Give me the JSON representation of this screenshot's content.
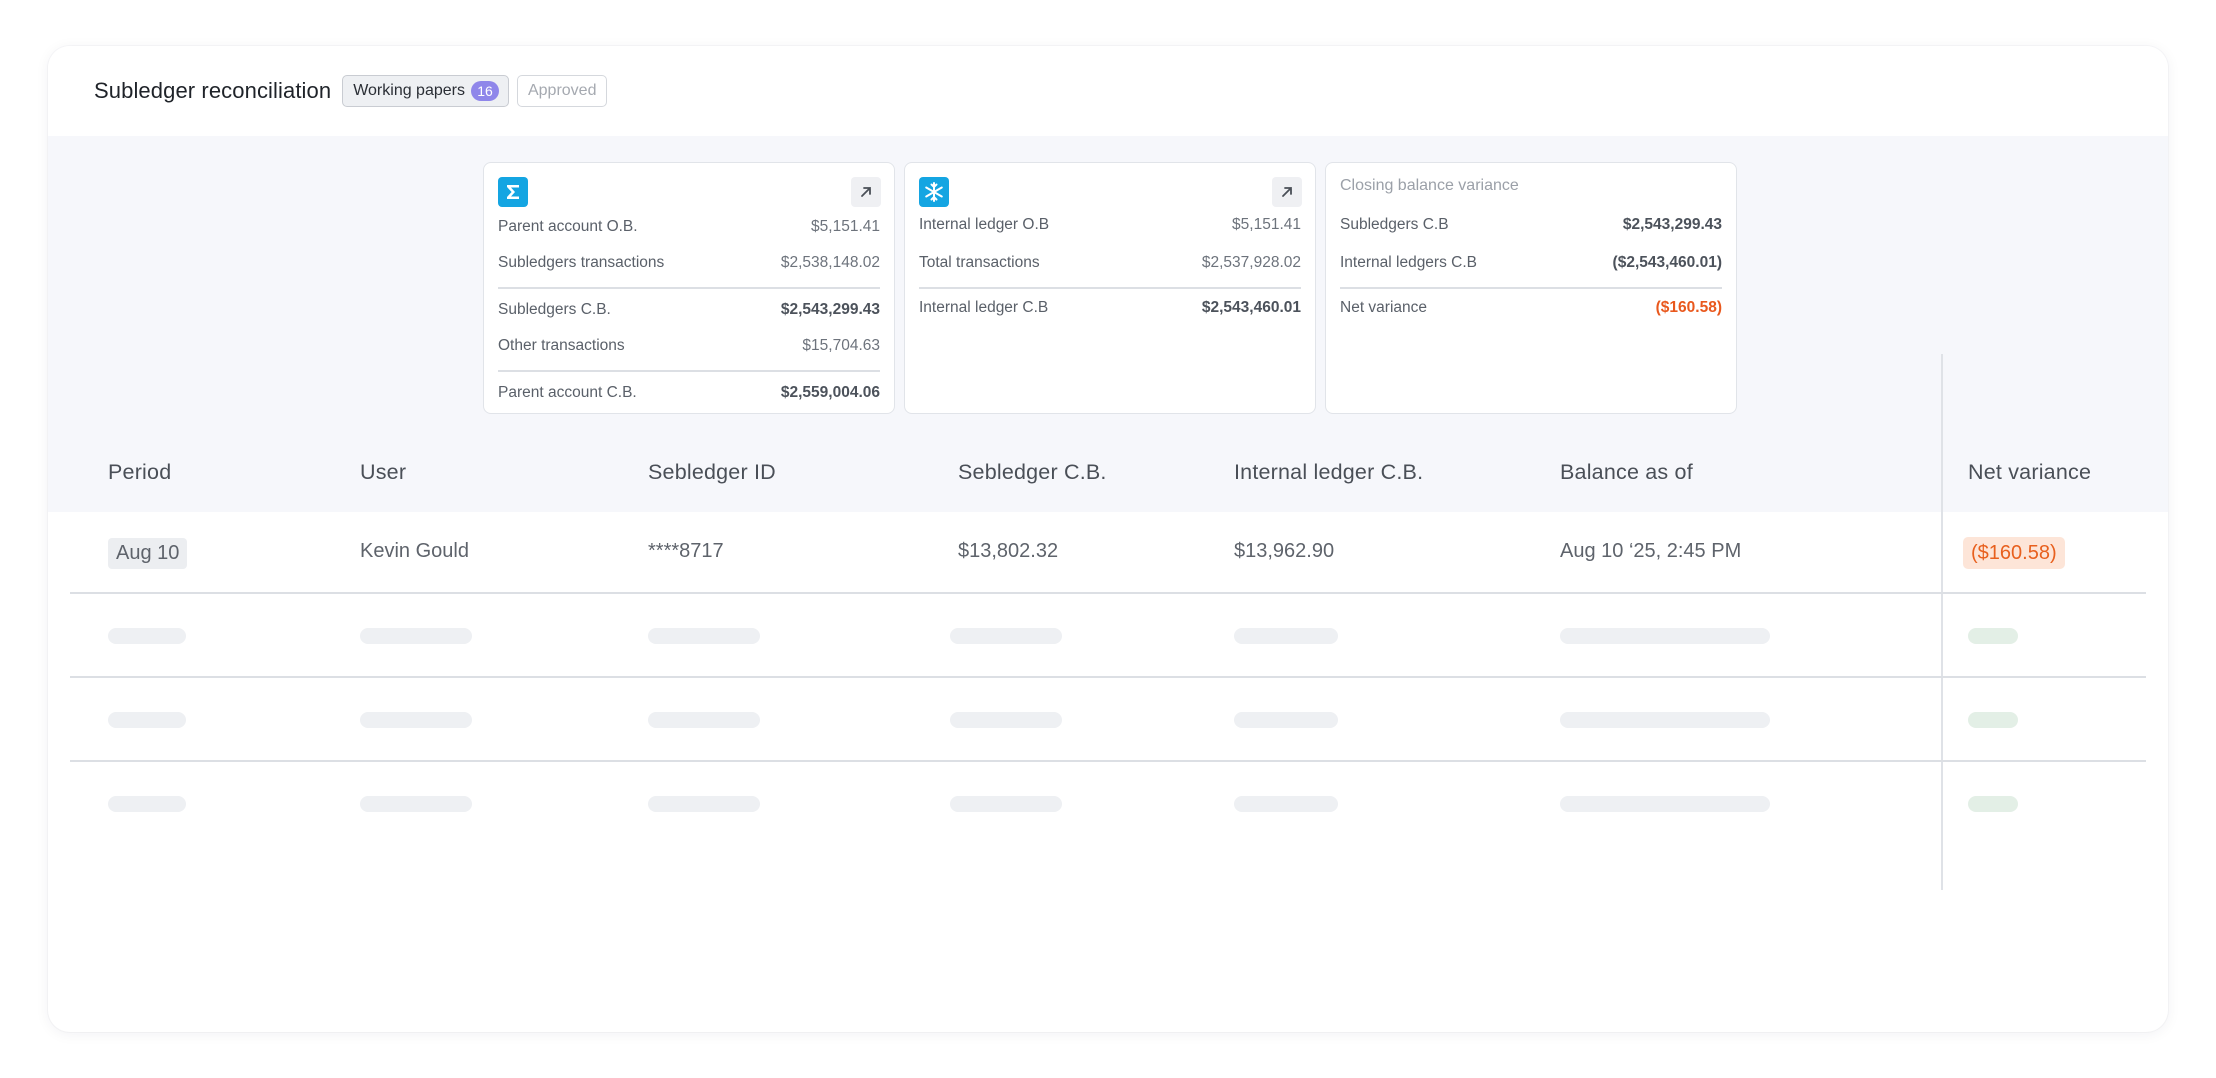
{
  "header": {
    "title": "Subledger reconciliation",
    "tabs": {
      "working_label": "Working papers",
      "working_count": "16",
      "approved_label": "Approved"
    }
  },
  "cards": {
    "parent": {
      "logo_icon": "sigma-logo-icon",
      "rows": [
        {
          "label": "Parent account O.B.",
          "value": "$5,151.41"
        },
        {
          "label": "Subledgers transactions",
          "value": "$2,538,148.02"
        },
        {
          "label": "Subledgers C.B.",
          "value": "$2,543,299.43"
        },
        {
          "label": "Other transactions",
          "value": "$15,704.63"
        },
        {
          "label": "Parent account C.B.",
          "value": "$2,559,004.06"
        }
      ]
    },
    "internal": {
      "logo_icon": "snowflake-logo-icon",
      "rows": [
        {
          "label": "Internal ledger O.B",
          "value": "$5,151.41"
        },
        {
          "label": "Total transactions",
          "value": "$2,537,928.02"
        },
        {
          "label": "Internal ledger C.B",
          "value": "$2,543,460.01"
        }
      ]
    },
    "variance": {
      "title": "Closing balance variance",
      "rows": [
        {
          "label": "Subledgers C.B",
          "value": "$2,543,299.43"
        },
        {
          "label": "Internal ledgers C.B",
          "value": "($2,543,460.01)"
        },
        {
          "label": "Net variance",
          "value": "($160.58)"
        }
      ]
    }
  },
  "table": {
    "columns": [
      "Period",
      "User",
      "Sebledger ID",
      "Sebledger C.B.",
      "Internal ledger C.B.",
      "Balance as of",
      "Net variance"
    ],
    "rows": [
      {
        "period": "Aug 10",
        "user": "Kevin Gould",
        "subledger_id": "****8717",
        "subledger_cb": "$13,802.32",
        "internal_cb": "$13,962.90",
        "balance_as_of": "Aug 10 ‘25, 2:45 PM",
        "net_variance": "($160.58)"
      }
    ],
    "loading_rows": 3
  },
  "colors": {
    "accent_purple": "#8f86ea",
    "logo_blue": "#14a5e2",
    "variance_red": "#e9581d",
    "variance_chip_bg": "#fde5d8",
    "skeleton_green": "#e3efe6"
  }
}
